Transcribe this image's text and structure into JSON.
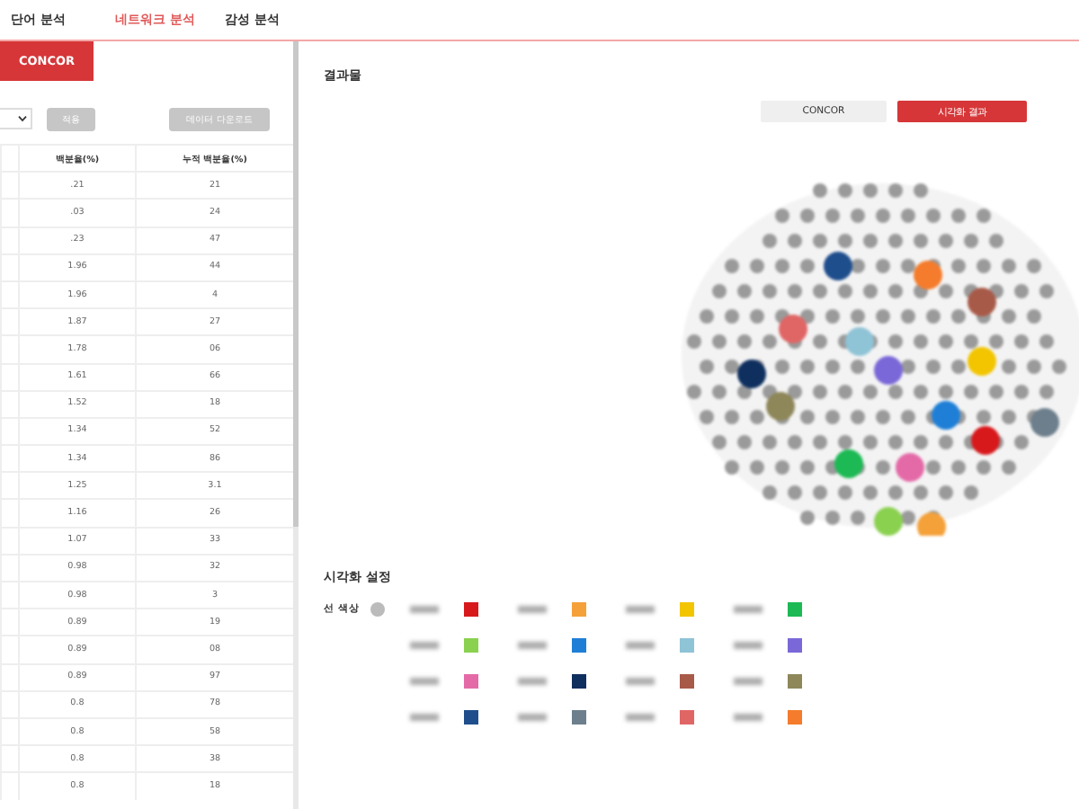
{
  "tabs": [
    {
      "label": "단어 분석",
      "selected": false
    },
    {
      "label": "네트워크 분석",
      "selected": true
    },
    {
      "label": "감성 분석",
      "selected": false
    }
  ],
  "left_panel": {
    "method_tab": {
      "label": "CONCOR",
      "selected": true
    },
    "apply_button": {
      "label": "적용",
      "disabled": true
    },
    "download_button": {
      "label": "데이터 다운로드",
      "disabled": true
    },
    "table": {
      "columns": [
        "백분율(%)",
        "누적 백분율(%)"
      ],
      "rows": [
        [
          ".21",
          "21"
        ],
        [
          ".03",
          "24"
        ],
        [
          ".23",
          "47"
        ],
        [
          "1.96",
          "44"
        ],
        [
          "1.96",
          "4"
        ],
        [
          "1.87",
          "27"
        ],
        [
          "1.78",
          "06"
        ],
        [
          "1.61",
          "66"
        ],
        [
          "1.52",
          "18"
        ],
        [
          "1.34",
          "52"
        ],
        [
          "1.34",
          "86"
        ],
        [
          "1.25",
          "3.1"
        ],
        [
          "1.16",
          "26"
        ],
        [
          "1.07",
          "33"
        ],
        [
          "0.98",
          "32"
        ],
        [
          "0.98",
          "3"
        ],
        [
          "0.89",
          "19"
        ],
        [
          "0.89",
          "08"
        ],
        [
          "0.89",
          "97"
        ],
        [
          "0.8",
          "78"
        ],
        [
          "0.8",
          "58"
        ],
        [
          "0.8",
          "38"
        ],
        [
          "0.8",
          "18"
        ]
      ]
    }
  },
  "result": {
    "title": "결과물",
    "views": [
      {
        "label": "CONCOR",
        "selected": false
      },
      {
        "label": "시각화 결과",
        "selected": true
      }
    ]
  },
  "settings": {
    "title": "시각화 설정",
    "line_color_label": "선 색상",
    "swatches": [
      {
        "color": "#d7191c"
      },
      {
        "color": "#f4a13a"
      },
      {
        "color": "#f2c500"
      },
      {
        "color": "#1db954"
      },
      {
        "color": "#8bd150"
      },
      {
        "color": "#1f7fd6"
      },
      {
        "color": "#8fc3d6"
      },
      {
        "color": "#7b68d8"
      },
      {
        "color": "#e46aa7"
      },
      {
        "color": "#0f2f5f"
      },
      {
        "color": "#a85a48"
      },
      {
        "color": "#8e875a"
      },
      {
        "color": "#1f4e8c"
      },
      {
        "color": "#6d7f8c"
      },
      {
        "color": "#e06666"
      },
      {
        "color": "#f47c2c"
      }
    ]
  }
}
